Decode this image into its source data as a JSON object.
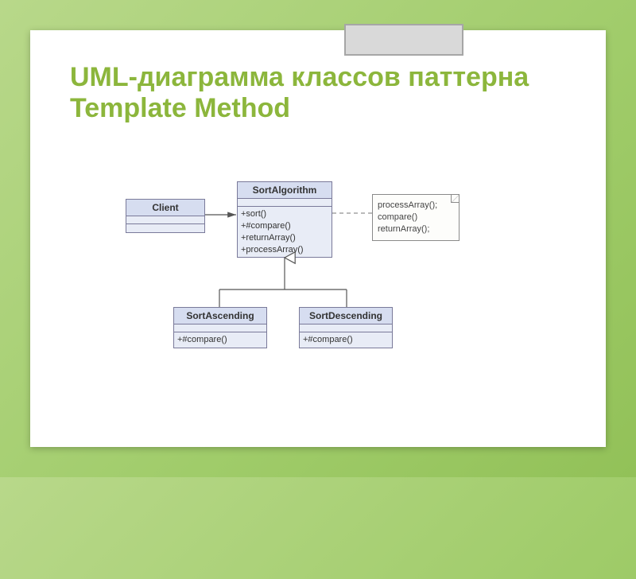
{
  "slide": {
    "title": "UML-диаграмма классов паттерна Template Method"
  },
  "classes": {
    "client": {
      "name": "Client",
      "attrs": [],
      "ops": []
    },
    "sortAlgorithm": {
      "name": "SortAlgorithm",
      "attrs": [],
      "ops": [
        "+sort()",
        "+#compare()",
        "+returnArray()",
        "+processArray()"
      ]
    },
    "sortAscending": {
      "name": "SortAscending",
      "attrs": [],
      "ops": [
        "+#compare()"
      ]
    },
    "sortDescending": {
      "name": "SortDescending",
      "attrs": [],
      "ops": [
        "+#compare()"
      ]
    }
  },
  "note": {
    "lines": [
      "processArray();",
      "compare()",
      "returnArray();"
    ]
  }
}
